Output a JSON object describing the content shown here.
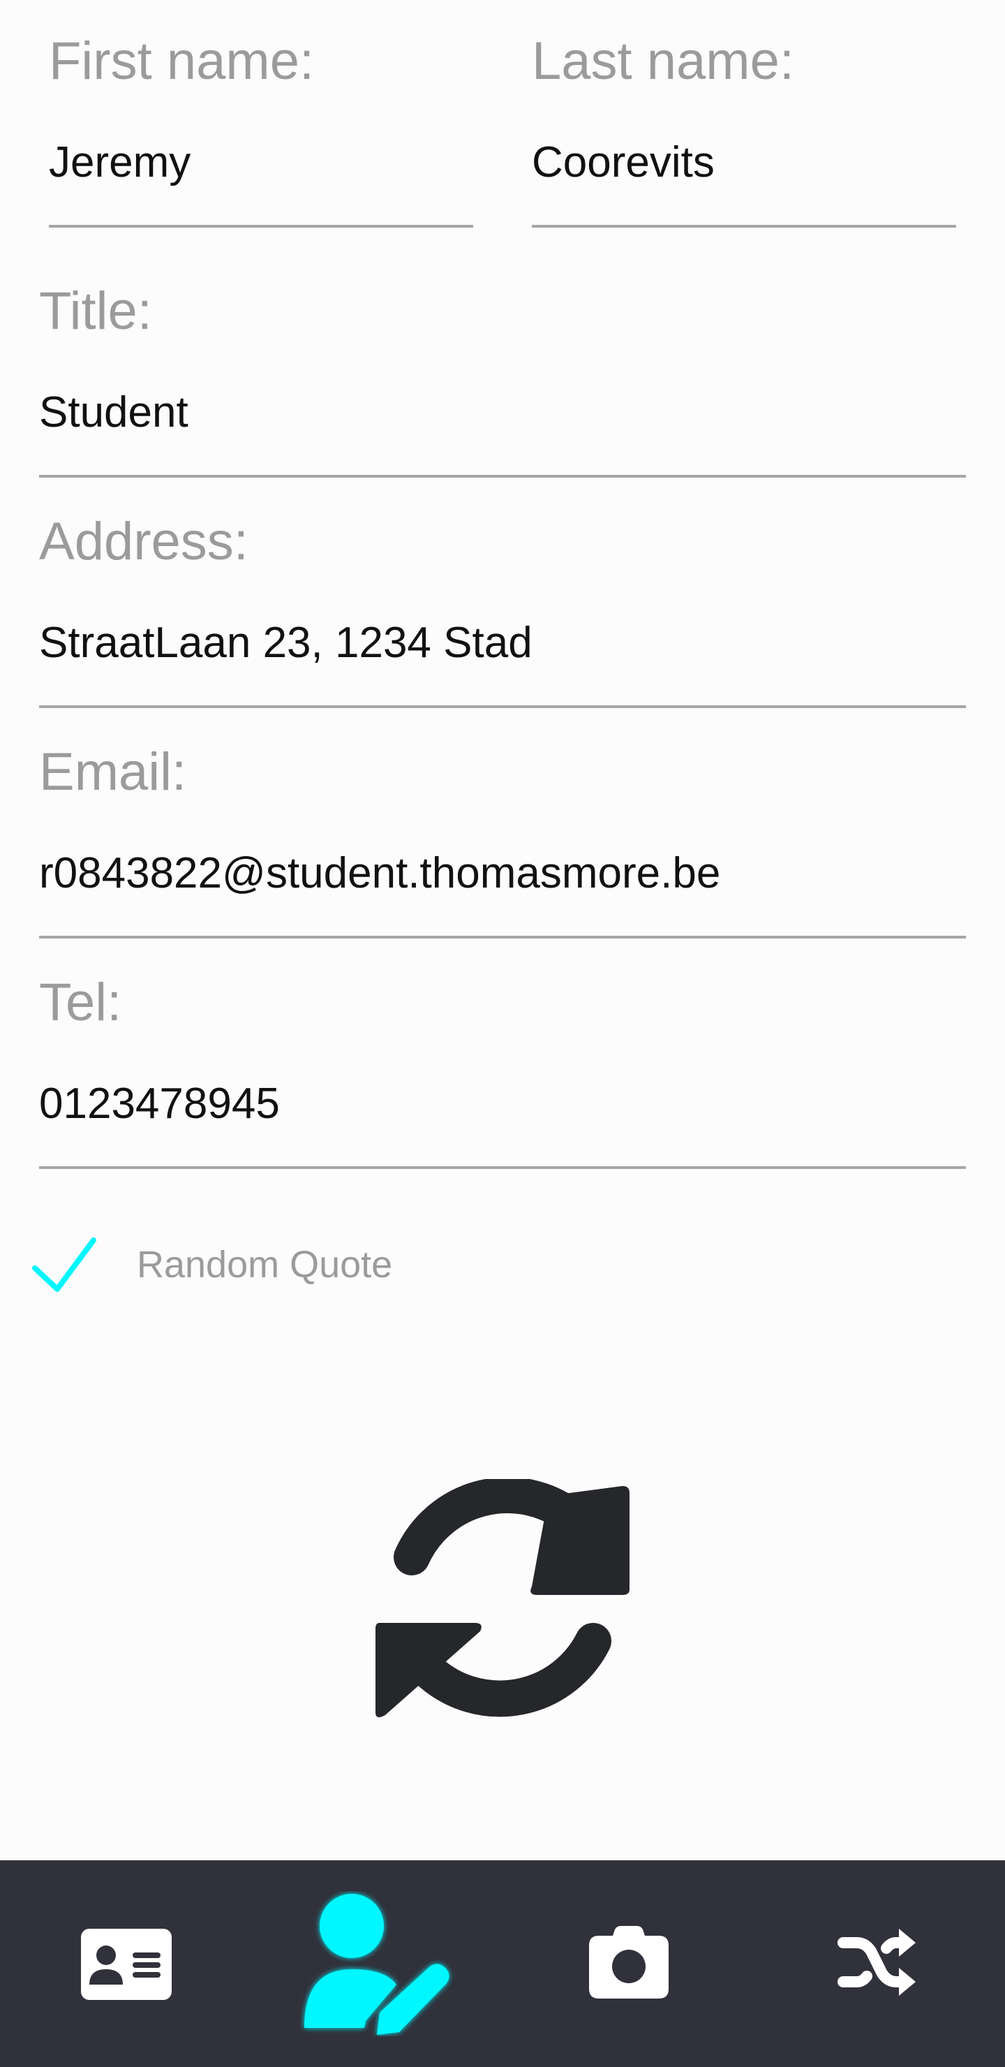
{
  "form": {
    "first_name": {
      "label": "First name:",
      "value": "Jeremy"
    },
    "last_name": {
      "label": "Last name:",
      "value": "Coorevits"
    },
    "title": {
      "label": "Title:",
      "value": "Student"
    },
    "address": {
      "label": "Address:",
      "value": "StraatLaan 23, 1234 Stad"
    },
    "email": {
      "label": "Email:",
      "value": "r0843822@student.thomasmore.be"
    },
    "tel": {
      "label": "Tel:",
      "value": "0123478945"
    }
  },
  "random_quote": {
    "label": "Random Quote",
    "checked": true
  },
  "refresh": {
    "icon": "refresh-icon"
  },
  "bottom_nav": {
    "items": [
      {
        "icon": "contact-card-icon",
        "active": false
      },
      {
        "icon": "user-edit-icon",
        "active": true
      },
      {
        "icon": "camera-icon",
        "active": false
      },
      {
        "icon": "shuffle-icon",
        "active": false
      }
    ]
  },
  "colors": {
    "accent": "#00f7ff",
    "nav_background": "#30313b",
    "label_gray": "#9b9b9b",
    "icon_dark": "#25272b",
    "nav_icon": "#ffffff"
  }
}
